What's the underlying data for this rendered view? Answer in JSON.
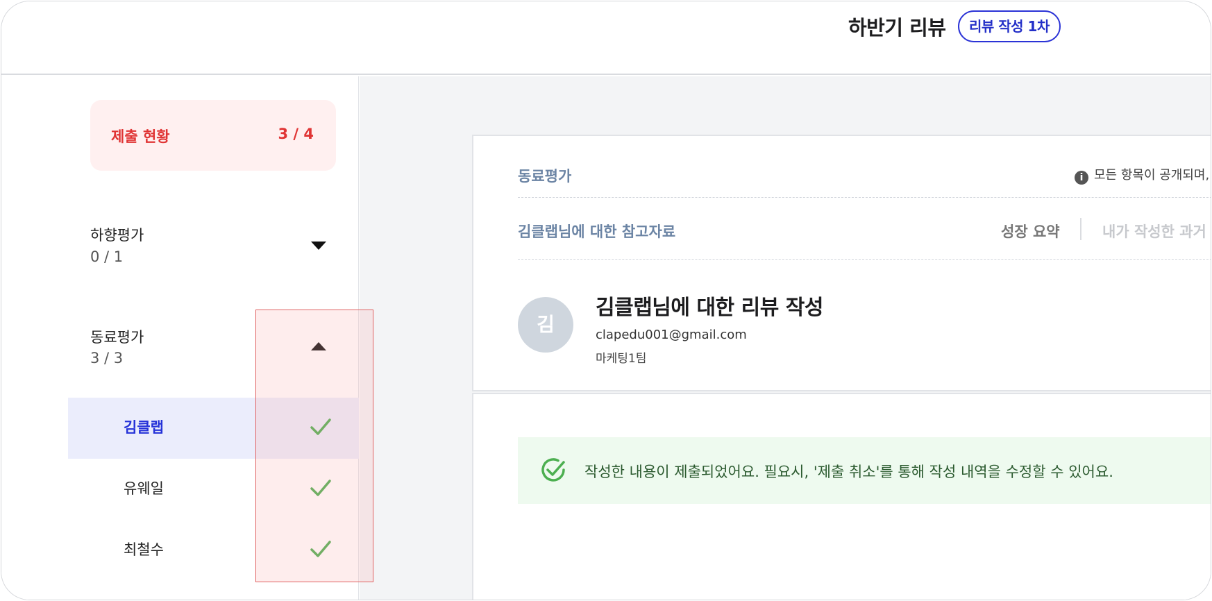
{
  "header": {
    "title": "하반기 리뷰",
    "badge": "리뷰 작성 1차"
  },
  "sidebar": {
    "status": {
      "label": "제출 현황",
      "count": "3 / 4"
    },
    "sections": [
      {
        "label": "하향평가",
        "count": "0 / 1",
        "expanded": false
      },
      {
        "label": "동료평가",
        "count": "3 / 3",
        "expanded": true
      }
    ],
    "peers": [
      {
        "name": "김클랩",
        "active": true,
        "done": true
      },
      {
        "name": "유웨일",
        "active": false,
        "done": true
      },
      {
        "name": "최철수",
        "active": false,
        "done": true
      }
    ]
  },
  "main": {
    "section_title": "동료평가",
    "notice": "모든 항목이 공개되며,",
    "reference": {
      "title": "김클랩님에 대한 참고자료",
      "tabs": [
        "성장 요약",
        "내가 작성한 과거"
      ]
    },
    "target": {
      "avatar": "김",
      "title": "김클랩님에 대한 리뷰 작성",
      "email": "clapedu001@gmail.com",
      "team": "마케팅1팀"
    },
    "banner": "작성한 내용이 제출되었어요. 필요시, '제출 취소'를 통해 작성 내역을 수정할 수 있어요."
  },
  "colors": {
    "accent": "#2532d8",
    "danger": "#e03434",
    "success": "#4caf50"
  }
}
